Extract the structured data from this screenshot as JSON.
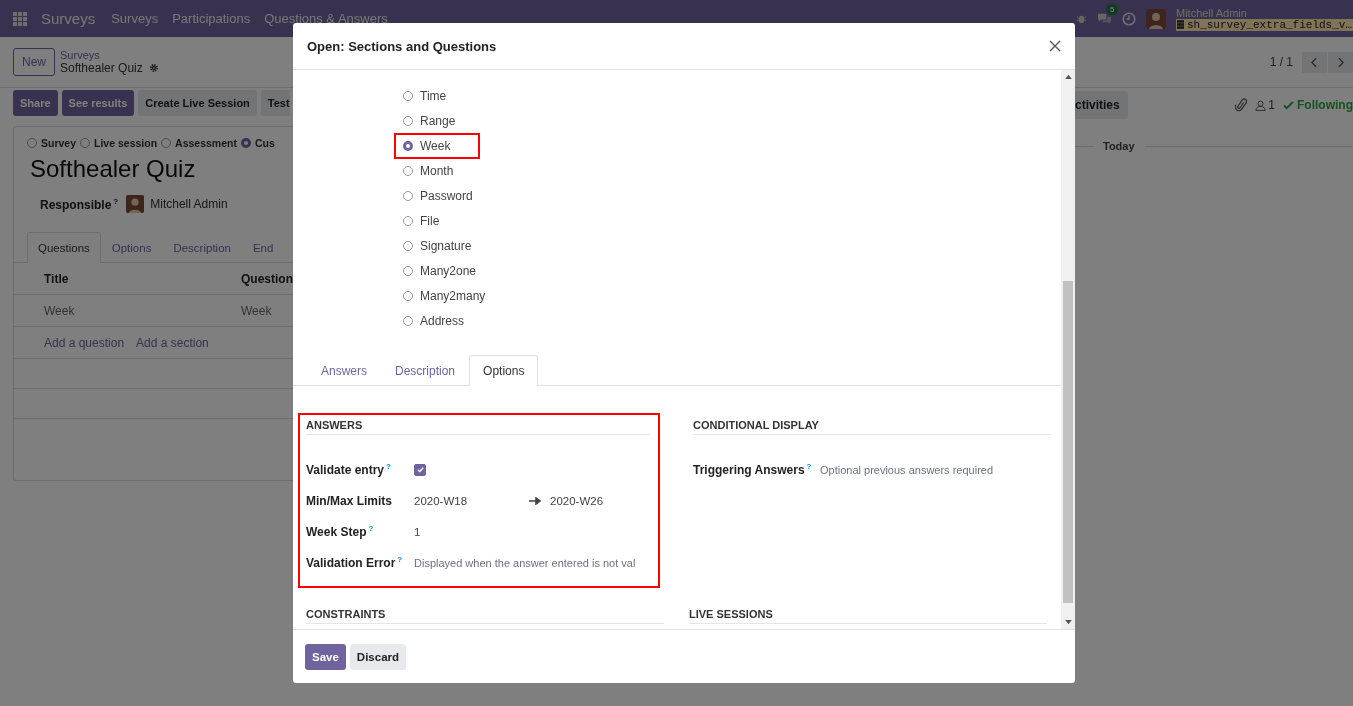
{
  "navbar": {
    "app": "Surveys",
    "menu": [
      "Surveys",
      "Participations",
      "Questions & Answers"
    ],
    "message_count": "5",
    "user": "Mitchell Admin",
    "database": "sh_survey_extra_fields_v…"
  },
  "control_panel": {
    "new_button": "New",
    "breadcrumb": [
      "Surveys",
      "Softhealer Quiz"
    ],
    "pager": "1 / 1"
  },
  "action_buttons": [
    {
      "label": "Share",
      "kind": "primary"
    },
    {
      "label": "See results",
      "kind": "primary"
    },
    {
      "label": "Create Live Session",
      "kind": "secondary"
    },
    {
      "label": "Test",
      "kind": "secondary"
    }
  ],
  "survey_types": [
    {
      "label": "Survey",
      "selected": false
    },
    {
      "label": "Live session",
      "selected": false
    },
    {
      "label": "Assessment",
      "selected": false
    },
    {
      "label": "Cus",
      "selected": true
    }
  ],
  "title": "Softhealer Quiz",
  "responsible": {
    "label": "Responsible",
    "hint": "?",
    "value": "Mitchell Admin"
  },
  "form_tabs": [
    {
      "label": "Questions",
      "selected": true
    },
    {
      "label": "Options",
      "selected": false
    },
    {
      "label": "Description",
      "selected": false
    },
    {
      "label": "End",
      "selected": false
    }
  ],
  "questions_table": {
    "columns": [
      "Title",
      "Question"
    ],
    "rows": [
      [
        "Week",
        "Week"
      ]
    ],
    "add_links": [
      "Add a question",
      "Add a section"
    ]
  },
  "chatter": {
    "activities_button": "ctivities",
    "followers": "1",
    "following": "Following",
    "date_separator": "Today"
  },
  "dialog": {
    "title": "Open: Sections and Questions",
    "question_types": [
      {
        "label": "Time",
        "selected": false,
        "highlighted": false
      },
      {
        "label": "Range",
        "selected": false,
        "highlighted": false
      },
      {
        "label": "Week",
        "selected": true,
        "highlighted": true
      },
      {
        "label": "Month",
        "selected": false,
        "highlighted": false
      },
      {
        "label": "Password",
        "selected": false,
        "highlighted": false
      },
      {
        "label": "File",
        "selected": false,
        "highlighted": false
      },
      {
        "label": "Signature",
        "selected": false,
        "highlighted": false
      },
      {
        "label": "Many2one",
        "selected": false,
        "highlighted": false
      },
      {
        "label": "Many2many",
        "selected": false,
        "highlighted": false
      },
      {
        "label": "Address",
        "selected": false,
        "highlighted": false
      }
    ],
    "tabs": [
      {
        "label": "Answers",
        "selected": false
      },
      {
        "label": "Description",
        "selected": false
      },
      {
        "label": "Options",
        "selected": true
      }
    ],
    "answers_section": {
      "heading": "ANSWERS",
      "highlighted": true,
      "fields": [
        {
          "kind": "checkbox",
          "label": "Validate entry",
          "hint": "?",
          "checked": true
        },
        {
          "kind": "range",
          "label": "Min/Max Limits",
          "min": "2020-W18",
          "max": "2020-W26"
        },
        {
          "kind": "text",
          "label": "Week Step",
          "hint": "?",
          "value": "1"
        },
        {
          "kind": "input",
          "label": "Validation Error",
          "hint": "?",
          "placeholder": "Displayed when the answer entered is not val"
        }
      ]
    },
    "conditional_section": {
      "heading": "CONDITIONAL DISPLAY",
      "fields": [
        {
          "kind": "input",
          "label": "Triggering Answers",
          "hint": "?",
          "placeholder": "Optional previous answers required"
        }
      ]
    },
    "lower_sections": [
      "CONSTRAINTS",
      "LIVE SESSIONS"
    ],
    "buttons": [
      {
        "label": "Save",
        "kind": "primary"
      },
      {
        "label": "Discard",
        "kind": "secondary"
      }
    ]
  }
}
